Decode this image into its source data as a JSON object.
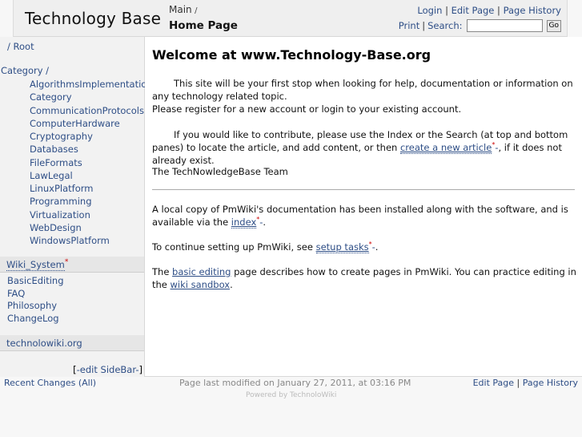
{
  "header": {
    "site_title": "Technology Base",
    "group": "Main",
    "group_sep": "/",
    "page_title": "Home Page",
    "actions_row1": [
      "Login",
      "Edit Page",
      "Page History"
    ],
    "print_label": "Print",
    "search_label": "Search:",
    "search_value": "",
    "go_label": "Go"
  },
  "sidebar": {
    "root_label": "/ Root",
    "category_title": "Category /",
    "categories": [
      "AlgorithmsImplementations",
      "Category",
      "CommunicationProtocols",
      "ComputerHardware",
      "Cryptography",
      "Databases",
      "FileFormats",
      "LawLegal",
      "LinuxPlatform",
      "Programming",
      "Virtualization",
      "WebDesign",
      "WindowsPlatform"
    ],
    "wiki_system_label": "Wiki_System",
    "missing_marker": "*",
    "wiki_items": [
      "BasicEditing",
      "FAQ",
      "Philosophy",
      "ChangeLog"
    ],
    "external_label": "technolowiki.org",
    "edit_open": "[",
    "edit_label": "-edit SideBar-",
    "edit_close": "]"
  },
  "content": {
    "heading": "Welcome at www.Technology-Base.org",
    "p1_line1": "This site will be your first stop when looking for help, documentation or information on any technology related topic.",
    "p1_line2": "Please register for a new account or login to your existing account.",
    "p2_before": "If you would like to contribute, please use the Index or the Search (at top and bottom panes) to locate the article, and add content, or then ",
    "p2_link": "create a new article",
    "p2_after": ", if it does not already exist.",
    "signature": "The TechNowledgeBase Team",
    "p3_before": "A local copy of PmWiki's documentation has been installed along with the software, and is available via the ",
    "p3_link": "index",
    "p3_after": ".",
    "p4_before": "To continue setting up PmWiki, see ",
    "p4_link": "setup tasks",
    "p4_after": ".",
    "p5_before": "The ",
    "p5_link1": "basic editing",
    "p5_mid": " page describes how to create pages in PmWiki. You can practice editing in the ",
    "p5_link2": "wiki sandbox",
    "p5_after": ".",
    "missing_marker": "*",
    "missing_dash": "-"
  },
  "footer": {
    "recent_changes": "Recent Changes (All)",
    "last_modified": "Page last modified on January 27, 2011, at 03:16 PM",
    "edit_page": "Edit Page",
    "page_history": "Page History",
    "powered_by": "Powered by TechnoloWiki"
  }
}
